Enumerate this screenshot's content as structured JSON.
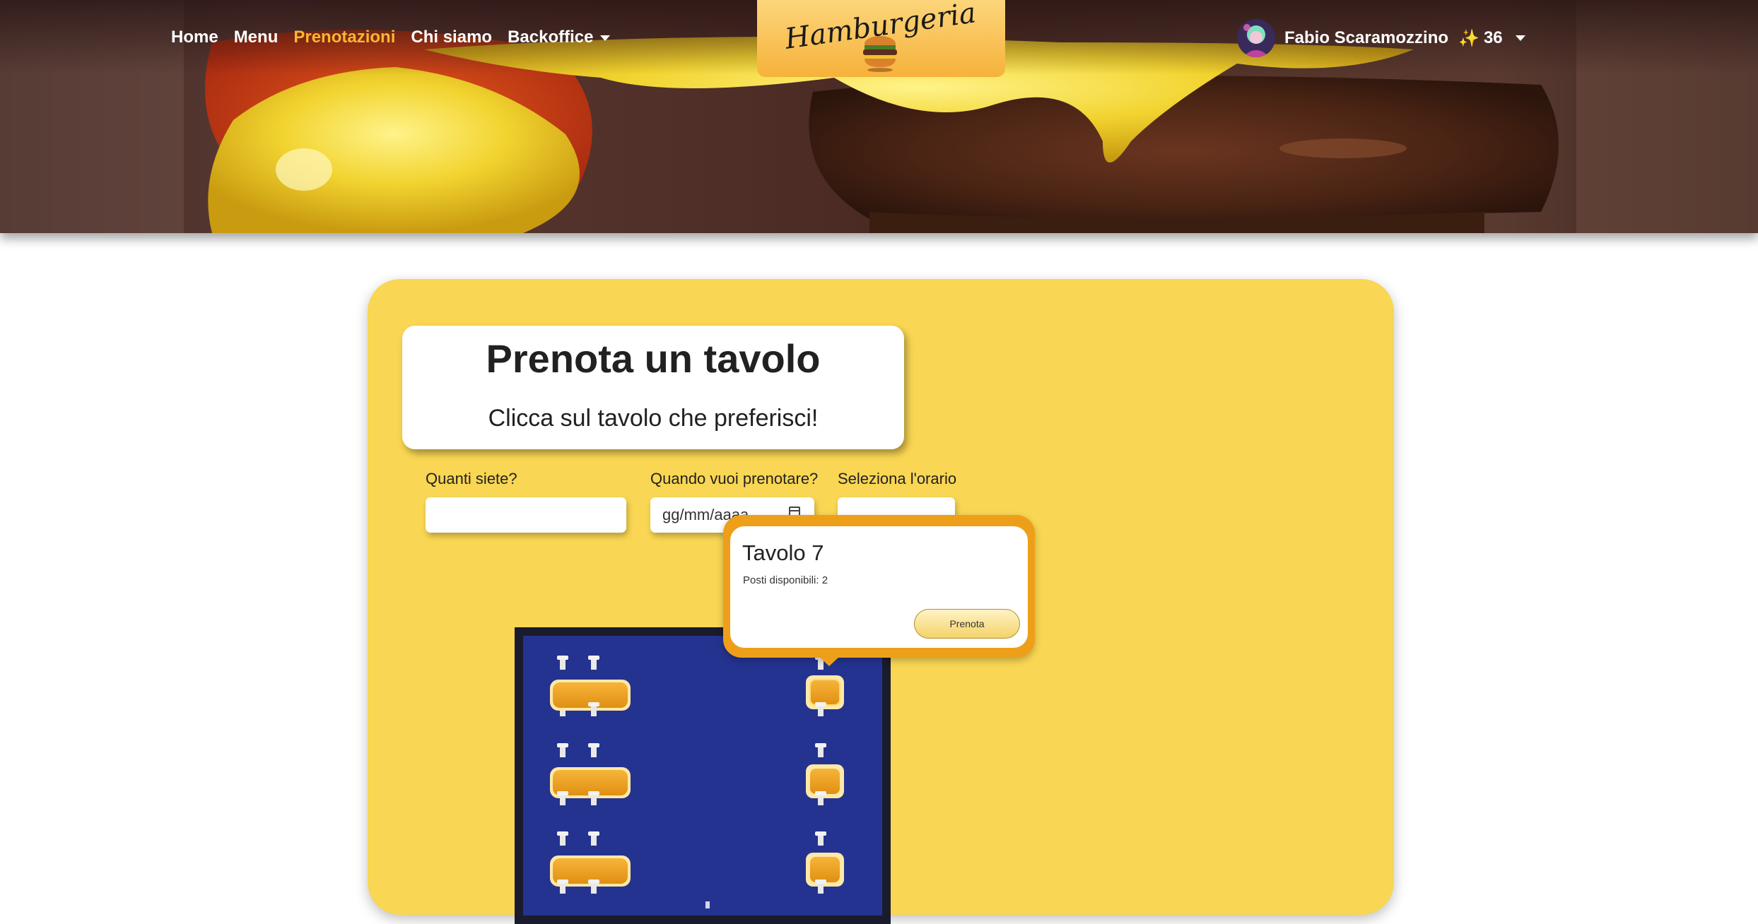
{
  "nav": {
    "items": [
      {
        "label": "Home",
        "active": false
      },
      {
        "label": "Menu",
        "active": false
      },
      {
        "label": "Prenotazioni",
        "active": true
      },
      {
        "label": "Chi siamo",
        "active": false
      }
    ],
    "backoffice_label": "Backoffice",
    "active_color": "#f8b630"
  },
  "logo": {
    "text": "Hamburgeria"
  },
  "user": {
    "name": "Fabio Scaramozzino",
    "sparkle": "✨",
    "points": "36"
  },
  "card": {
    "background": "#f9d653"
  },
  "booking": {
    "title": "Prenota un tavolo",
    "subtitle": "Clicca sul tavolo che preferisci!",
    "people_label": "Quanti siete?",
    "people_value": "",
    "date_label": "Quando vuoi prenotare?",
    "date_placeholder": "gg/mm/aaaa",
    "time_label": "Seleziona l'orario",
    "time_value": ""
  },
  "popover": {
    "title": "Tavolo 7",
    "seats_text": "Posti disponibili: 2",
    "button_label": "Prenota"
  },
  "floor_map": {
    "floor_color": "#24338f",
    "table_color": "#eea21c",
    "selected_table": "Tavolo 7"
  }
}
